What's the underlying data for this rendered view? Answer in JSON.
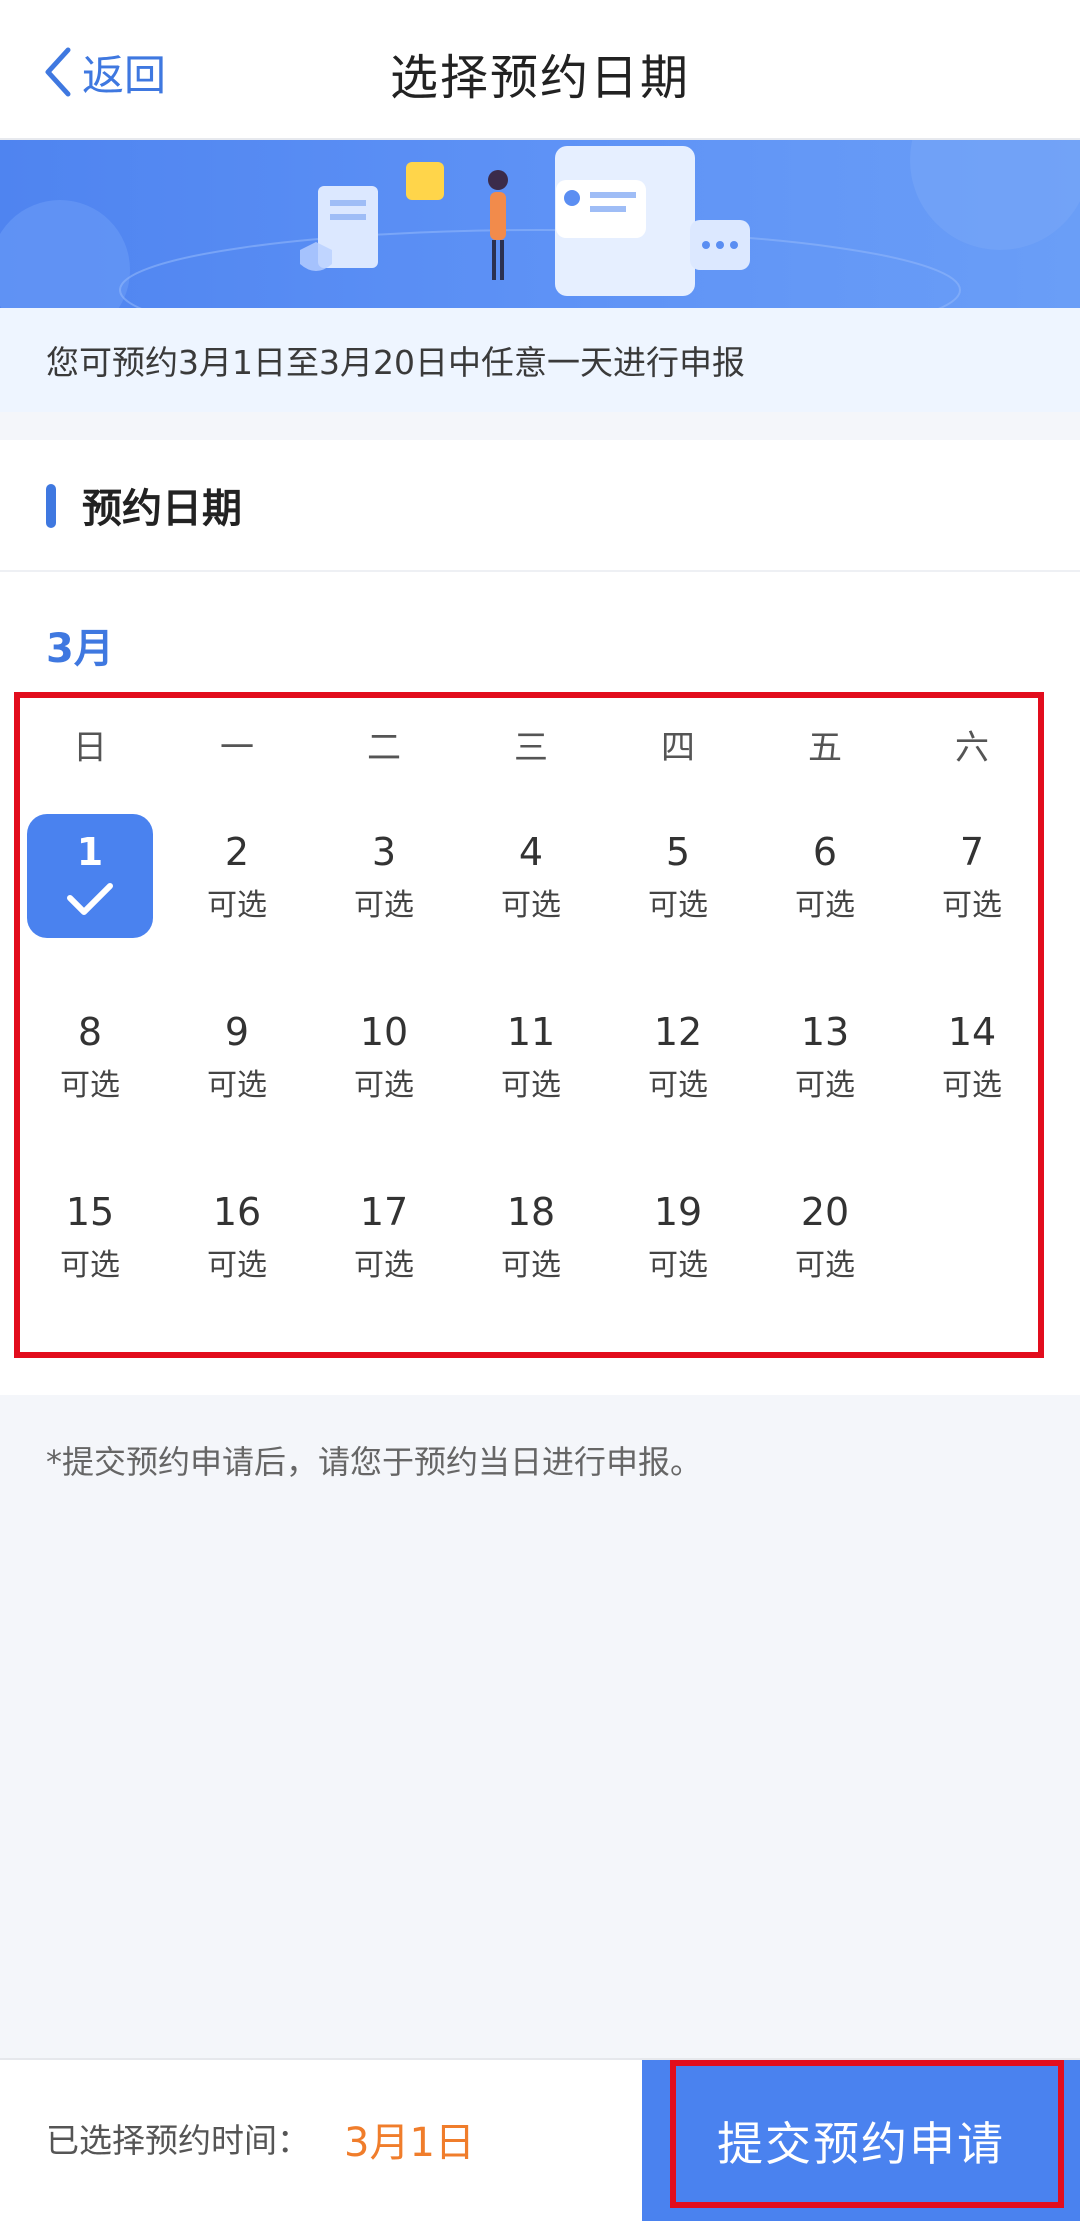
{
  "nav": {
    "back_label": "返回",
    "title": "选择预约日期"
  },
  "notice": "您可预约3月1日至3月20日中任意一天进行申报",
  "section": {
    "title": "预约日期"
  },
  "calendar": {
    "month": "3月",
    "weekdays": [
      "日",
      "一",
      "二",
      "三",
      "四",
      "五",
      "六"
    ],
    "selected_day": "1",
    "days": [
      {
        "num": "1",
        "status": ""
      },
      {
        "num": "2",
        "status": "可选"
      },
      {
        "num": "3",
        "status": "可选"
      },
      {
        "num": "4",
        "status": "可选"
      },
      {
        "num": "5",
        "status": "可选"
      },
      {
        "num": "6",
        "status": "可选"
      },
      {
        "num": "7",
        "status": "可选"
      },
      {
        "num": "8",
        "status": "可选"
      },
      {
        "num": "9",
        "status": "可选"
      },
      {
        "num": "10",
        "status": "可选"
      },
      {
        "num": "11",
        "status": "可选"
      },
      {
        "num": "12",
        "status": "可选"
      },
      {
        "num": "13",
        "status": "可选"
      },
      {
        "num": "14",
        "status": "可选"
      },
      {
        "num": "15",
        "status": "可选"
      },
      {
        "num": "16",
        "status": "可选"
      },
      {
        "num": "17",
        "status": "可选"
      },
      {
        "num": "18",
        "status": "可选"
      },
      {
        "num": "19",
        "status": "可选"
      },
      {
        "num": "20",
        "status": "可选"
      }
    ]
  },
  "footnote": "*提交预约申请后，请您于预约当日进行申报。",
  "bottom": {
    "selected_label": "已选择预约时间：",
    "selected_value": "3月1日",
    "submit_label": "提交预约申请"
  },
  "colors": {
    "accent": "#4a82ef",
    "highlight": "#f07d2b",
    "annotation": "#e20d1d"
  }
}
